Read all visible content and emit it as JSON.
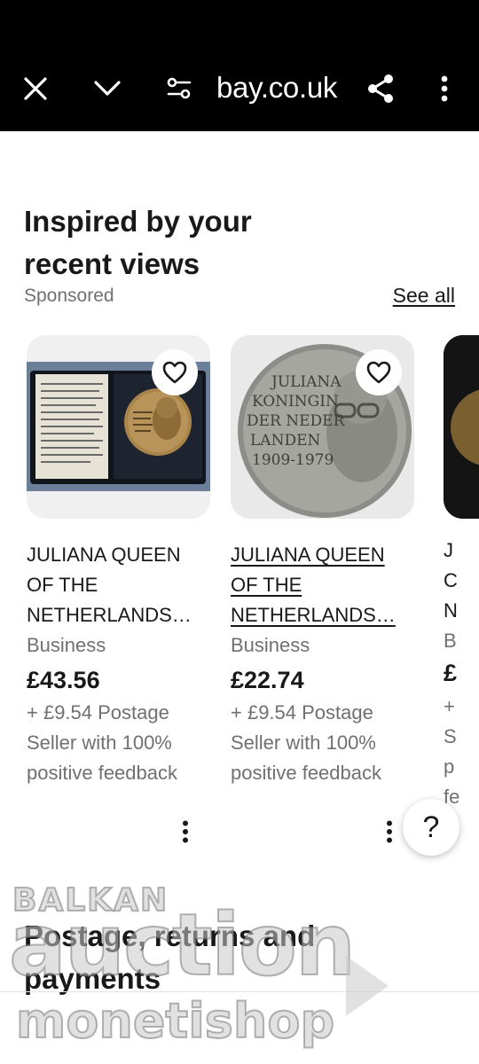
{
  "browser": {
    "url": "bay.co.uk"
  },
  "section": {
    "title": "Inspired by your recent views",
    "sponsored": "Sponsored",
    "see_all": "See all"
  },
  "items": [
    {
      "title": "JULIANA QUEEN OF THE NETHERLANDS…",
      "condition": "Business",
      "price": "£43.56",
      "postage": "+ £9.54 Postage",
      "seller": "Seller with 100% positive feedback"
    },
    {
      "title": "JULIANA QUEEN OF THE NETHERLANDS…",
      "condition": "Business",
      "price": "£22.74",
      "postage": "+ £9.54 Postage",
      "seller": "Seller with 100% positive feedback"
    }
  ],
  "peek": {
    "line1": "J",
    "line2": "C",
    "line3": "N",
    "line4": "B",
    "line5": "£",
    "line6": "+",
    "line7": "S",
    "line8": "p",
    "line9": "fe"
  },
  "medal_text": {
    "line1": "JULIANA",
    "line2": "KONINGIN",
    "line3": "DER NEDER",
    "line4": "LANDEN",
    "line5": "1909-1979"
  },
  "help": "?",
  "section2": {
    "title": "Postage, returns and payments"
  },
  "watermark": {
    "line1": "BALKAN",
    "line2": "auction",
    "line3": "monetishop"
  }
}
